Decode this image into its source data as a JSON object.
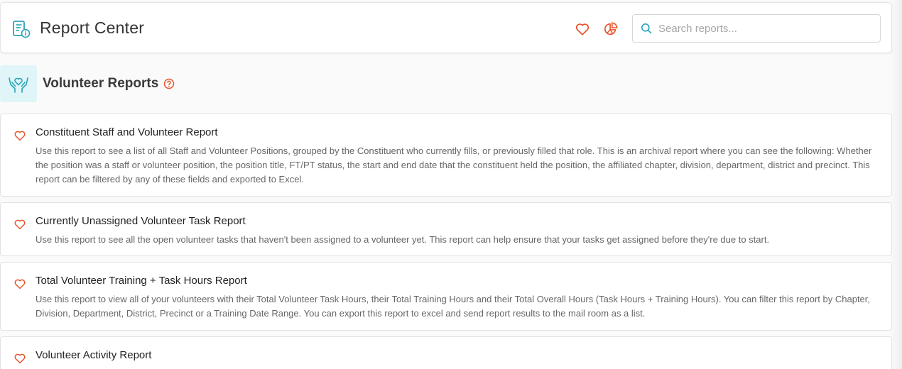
{
  "header": {
    "title": "Report Center",
    "app_icon": "report-document-icon",
    "favorites_icon": "heart-icon",
    "analytics_icon": "pie-chart-icon",
    "search": {
      "placeholder": "Search reports...",
      "value": "",
      "icon": "search-icon"
    }
  },
  "section": {
    "title": "Volunteer Reports",
    "icon": "hands-heart-icon",
    "help_icon": "help-circle-icon"
  },
  "reports": [
    {
      "title": "Constituent Staff and Volunteer Report",
      "description": "Use this report to see a list of all Staff and Volunteer Positions, grouped by the Constituent who currently fills, or previously filled that role. This is an archival report where you can see the following: Whether the position was a staff or volunteer position, the position title, FT/PT status, the start and end date that the constituent held the position, the affiliated chapter, division, department, district and precinct. This report can be filtered by any of these fields and exported to Excel."
    },
    {
      "title": "Currently Unassigned Volunteer Task Report",
      "description": "Use this report to see all the open volunteer tasks that haven't been assigned to a volunteer yet. This report can help ensure that your tasks get assigned before they're due to start."
    },
    {
      "title": "Total Volunteer Training + Task Hours Report",
      "description": "Use this report to view all of your volunteers with their Total Volunteer Task Hours, their Total Training Hours and their Total Overall Hours (Task Hours + Training Hours). You can filter this report by Chapter, Division, Department, District, Precinct or a Training Date Range. You can export this report to excel and send report results to the mail room as a list."
    },
    {
      "title": "Volunteer Activity Report",
      "description": ""
    }
  ],
  "colors": {
    "accent": "#e8542c",
    "teal": "#2aa3b8",
    "section_icon_bg": "#e0f5f8"
  }
}
